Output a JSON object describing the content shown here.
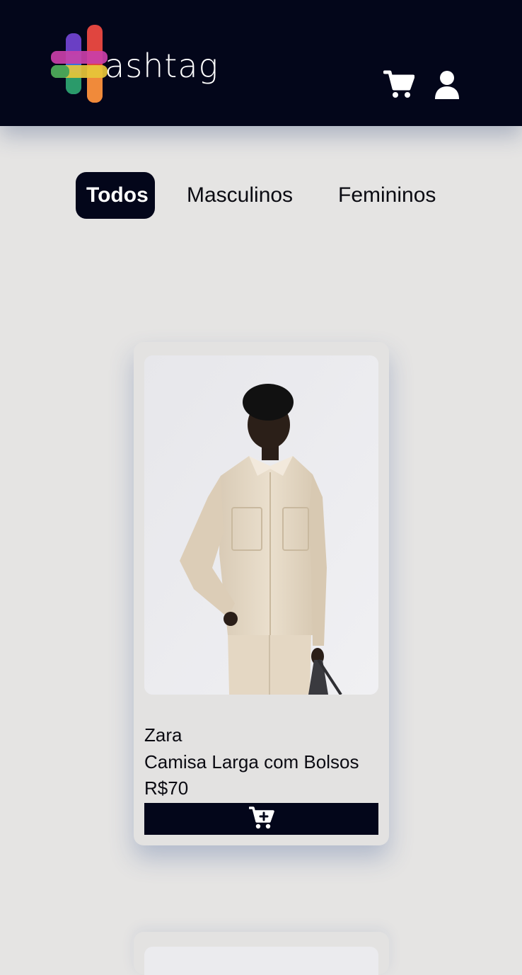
{
  "header": {
    "brand_text": "ashtag",
    "icons": [
      "hashtag-logo-icon",
      "cart-icon",
      "user-icon"
    ],
    "background_color": "#03061a"
  },
  "filters": {
    "tabs": [
      {
        "label": "Todos",
        "active": true
      },
      {
        "label": "Masculinos",
        "active": false
      },
      {
        "label": "Femininos",
        "active": false
      }
    ]
  },
  "products": [
    {
      "brand": "Zara",
      "name": "Camisa Larga com Bolsos",
      "price": "R$70",
      "image": "product-photo-man-beige-shirt",
      "button_icon": "cart-plus-icon"
    }
  ],
  "colors": {
    "page_background": "#e5e4e3",
    "accent_dark": "#03061a",
    "text": "#0b0b12"
  }
}
